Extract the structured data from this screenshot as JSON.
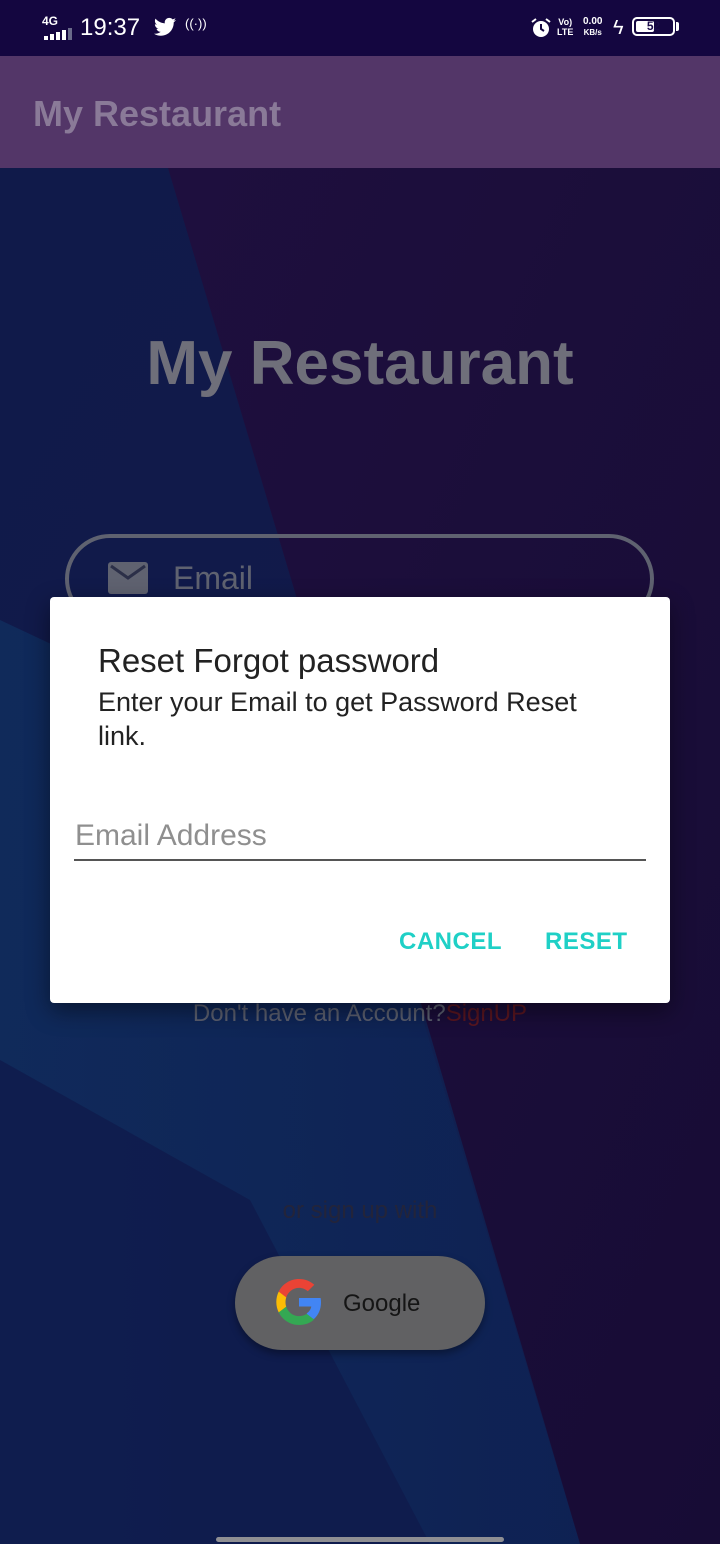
{
  "status_bar": {
    "network": "4G",
    "time": "19:37",
    "volte_top": "Vo)",
    "volte_bottom": "LTE",
    "speed_value": "0.00",
    "speed_unit": "KB/s",
    "battery": "52",
    "battery_level": 0.52
  },
  "app_bar": {
    "title": "My Restaurant"
  },
  "background": {
    "title": "My Restaurant",
    "email_label": "Email",
    "account_text": "Don't have an Account?",
    "signup_link": "SignUP",
    "or_sign_up": "or sign up with",
    "google_button": "Google"
  },
  "dialog": {
    "title": "Reset Forgot password",
    "message": "Enter your Email to get Password Reset link.",
    "email_placeholder": "Email Address",
    "email_value": "",
    "cancel_label": "CANCEL",
    "reset_label": "RESET"
  },
  "colors": {
    "accent": "#1fd0c6",
    "app_bar": "#533668",
    "status_bar": "#140640",
    "signup_link": "#5a1620"
  }
}
